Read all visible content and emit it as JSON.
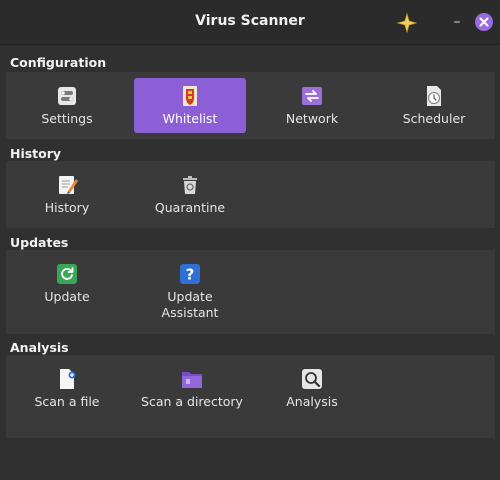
{
  "window": {
    "title": "Virus Scanner",
    "buttons": {
      "sparkle": "sparkle-icon",
      "minimize": "–",
      "close": "close-icon"
    },
    "accent": "#8c5fd6"
  },
  "sections": {
    "configuration": {
      "title": "Configuration",
      "items": [
        {
          "label": "Settings",
          "icon": "settings-toggle-icon",
          "active": false
        },
        {
          "label": "Whitelist",
          "icon": "whitelist-shield-icon",
          "active": true
        },
        {
          "label": "Network",
          "icon": "network-arrows-icon",
          "active": false
        },
        {
          "label": "Scheduler",
          "icon": "scheduler-clock-icon",
          "active": false
        }
      ]
    },
    "history": {
      "title": "History",
      "items": [
        {
          "label": "History",
          "icon": "history-notepad-icon"
        },
        {
          "label": "Quarantine",
          "icon": "quarantine-trash-icon"
        }
      ]
    },
    "updates": {
      "title": "Updates",
      "items": [
        {
          "label": "Update",
          "icon": "update-refresh-icon"
        },
        {
          "label_line1": "Update",
          "label_line2": "Assistant",
          "icon": "help-question-icon"
        }
      ]
    },
    "analysis": {
      "title": "Analysis",
      "items": [
        {
          "label": "Scan a file",
          "icon": "scan-file-icon"
        },
        {
          "label": "Scan a directory",
          "icon": "scan-folder-icon"
        },
        {
          "label": "Analysis",
          "icon": "analysis-magnifier-icon"
        }
      ]
    }
  }
}
